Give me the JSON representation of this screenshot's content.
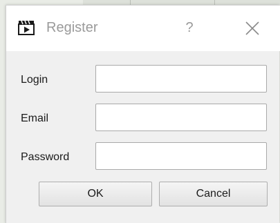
{
  "window": {
    "title": "Register",
    "help_label": "?"
  },
  "form": {
    "login": {
      "label": "Login",
      "value": "",
      "placeholder": ""
    },
    "email": {
      "label": "Email",
      "value": "",
      "placeholder": ""
    },
    "password": {
      "label": "Password",
      "value": "",
      "placeholder": ""
    }
  },
  "buttons": {
    "ok_label": "OK",
    "cancel_label": "Cancel"
  },
  "icons": {
    "app": "clapperboard-icon",
    "help": "help-icon",
    "close": "close-icon"
  }
}
